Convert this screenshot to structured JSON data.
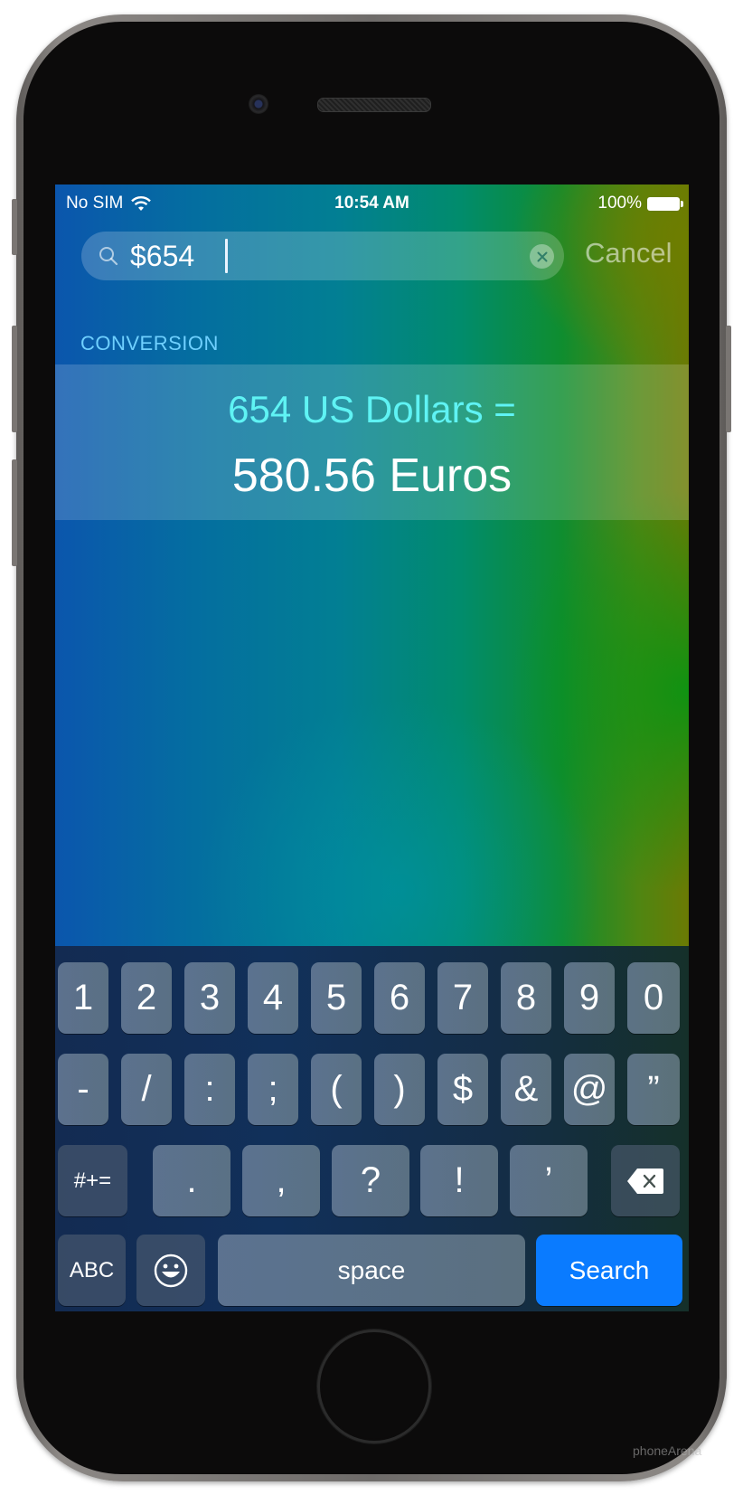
{
  "status_bar": {
    "carrier": "No SIM",
    "wifi_icon": "wifi-icon",
    "time": "10:54 AM",
    "battery_percent": "100%",
    "battery_icon": "battery-full-icon",
    "battery_level": 1.0
  },
  "search": {
    "value": "$654",
    "placeholder": "",
    "search_icon": "magnifier-icon",
    "clear_icon": "clear-x-icon",
    "cancel_label": "Cancel"
  },
  "results": {
    "section_header": "CONVERSION",
    "conversion": {
      "from_text": "654 US Dollars =",
      "to_text": "580.56 Euros"
    }
  },
  "keyboard": {
    "row1": [
      "1",
      "2",
      "3",
      "4",
      "5",
      "6",
      "7",
      "8",
      "9",
      "0"
    ],
    "row2": [
      "-",
      "/",
      ":",
      ";",
      "(",
      ")",
      "$",
      "&",
      "@",
      "”"
    ],
    "row3": {
      "shift_label": "#+=",
      "keys": [
        ".",
        ",",
        "?",
        "!",
        "’"
      ],
      "delete_icon": "backspace-icon"
    },
    "row4": {
      "abc_label": "ABC",
      "emoji_icon": "emoji-smiley-icon",
      "space_label": "space",
      "search_label": "Search"
    }
  },
  "colors": {
    "accent_search_key": "#0a7bff",
    "section_header": "#6fd0ff",
    "conversion_from": "#5ff3f4"
  },
  "watermark": "phoneArena"
}
